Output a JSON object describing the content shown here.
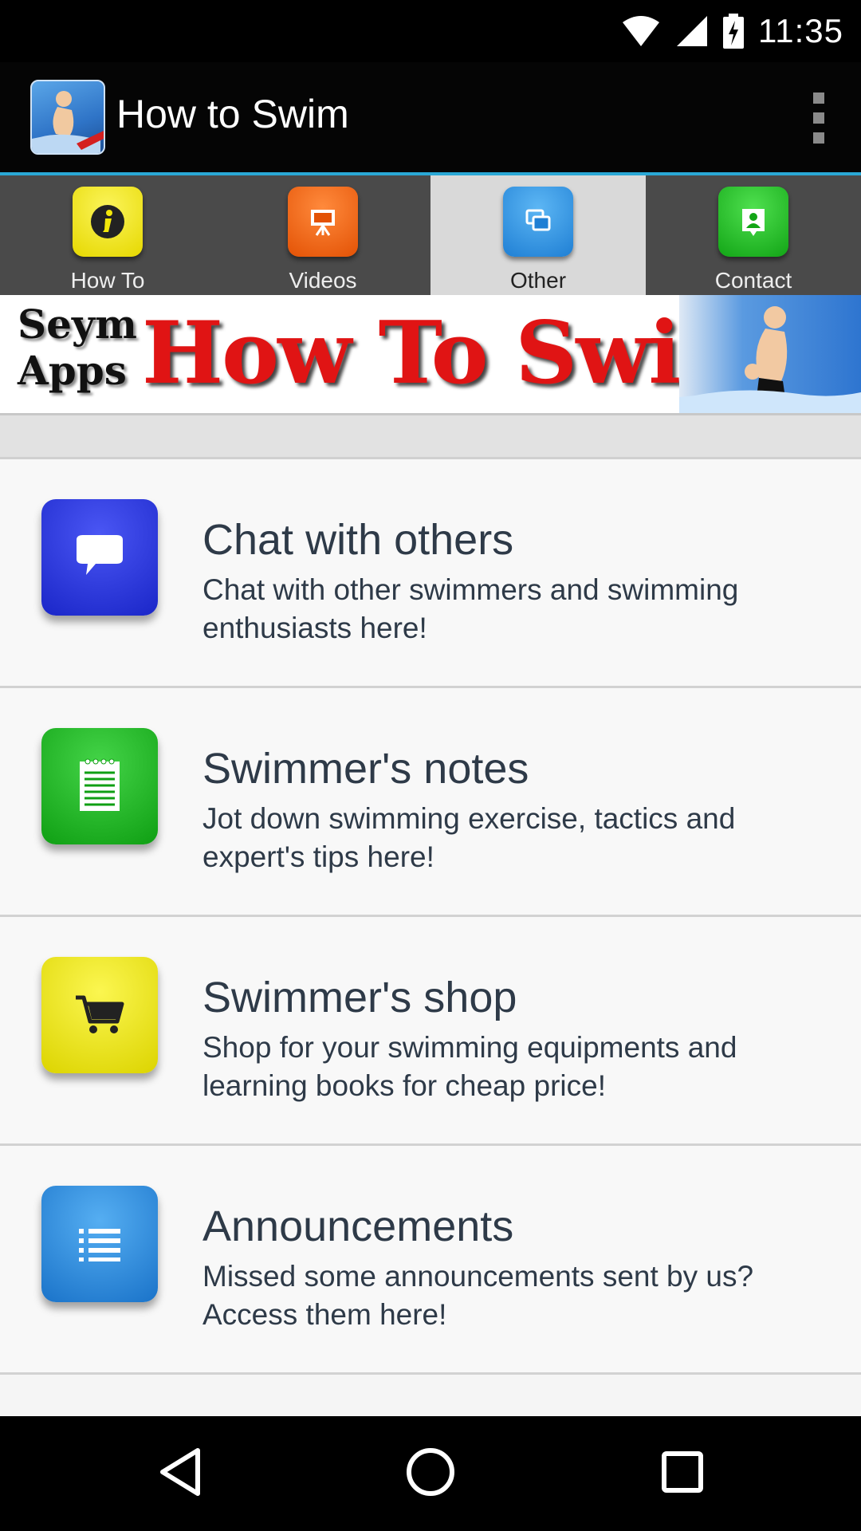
{
  "status_bar": {
    "time": "11:35"
  },
  "app": {
    "title": "How to Swim"
  },
  "tabs": [
    {
      "label": "How To",
      "icon": "info-icon",
      "color": "#f2e70a",
      "selected": false
    },
    {
      "label": "Videos",
      "icon": "presentation-icon",
      "color": "#f06010",
      "selected": false
    },
    {
      "label": "Other",
      "icon": "windows-icon",
      "color": "#2a8fe0",
      "selected": true
    },
    {
      "label": "Contact",
      "icon": "contact-icon",
      "color": "#19b81b",
      "selected": false
    }
  ],
  "banner": {
    "line1": "Seym",
    "line2": "Apps",
    "title": "How To Swim"
  },
  "items": [
    {
      "title": "Chat with others",
      "desc": "Chat with other swimmers and swimming enthusiasts here!",
      "icon": "chat-icon",
      "color": "#2233dd"
    },
    {
      "title": "Swimmer's notes",
      "desc": "Jot down swimming exercise, tactics and expert's tips here!",
      "icon": "notepad-icon",
      "color": "#16b51a"
    },
    {
      "title": "Swimmer's shop",
      "desc": "Shop for your swimming equipments and learning books for cheap price!",
      "icon": "cart-icon",
      "color": "#f0e808"
    },
    {
      "title": "Announcements",
      "desc": "Missed some announcements sent by us? Access them here!",
      "icon": "list-icon",
      "color": "#2a88da"
    }
  ],
  "colors": {
    "tab_accent": "#2aa8d6",
    "text": "#2e3a48"
  }
}
